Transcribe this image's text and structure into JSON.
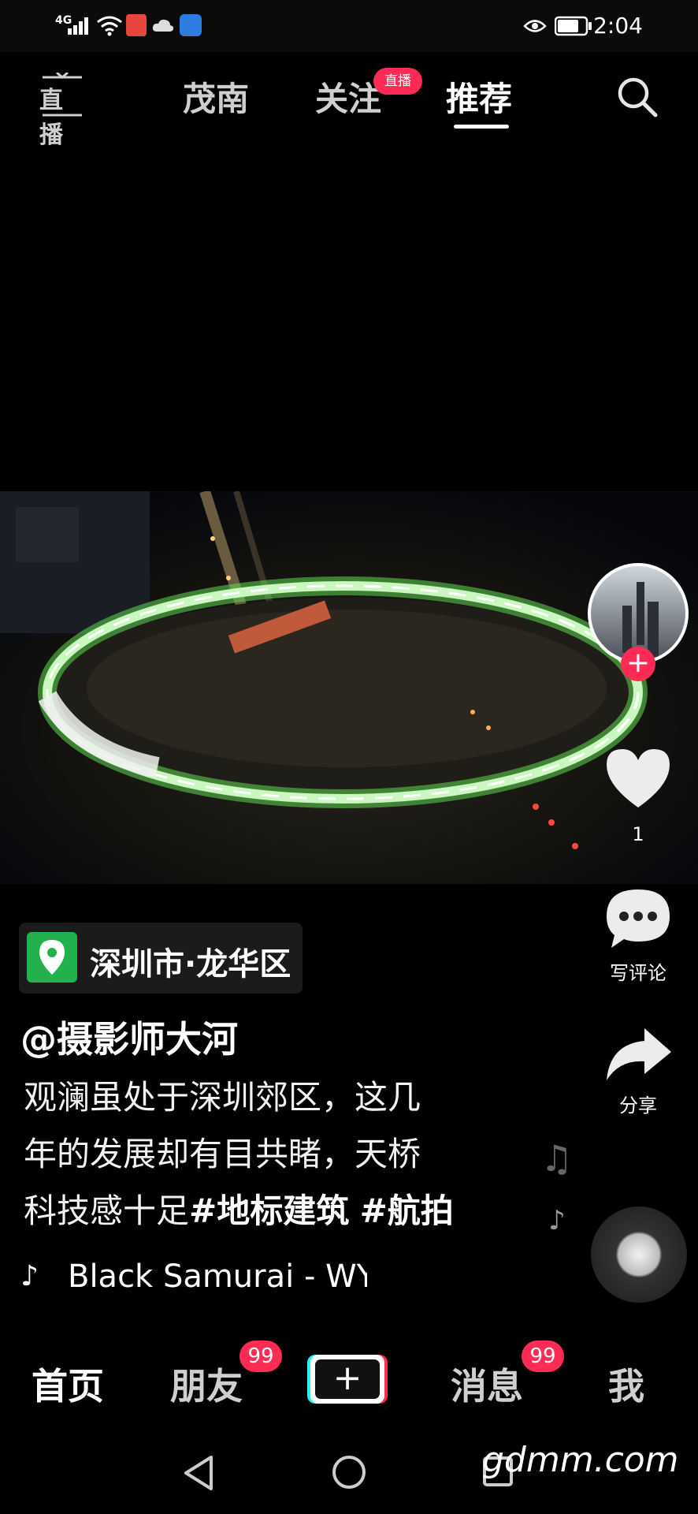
{
  "status_bar": {
    "network": "4G",
    "time": "2:04"
  },
  "top_nav": {
    "live_icon_label": "直播",
    "tabs": [
      {
        "label": "茂南",
        "active": false
      },
      {
        "label": "关注",
        "active": false,
        "badge": "直播"
      },
      {
        "label": "推荐",
        "active": true
      }
    ]
  },
  "rail": {
    "likes": "1",
    "comment_label": "写评论",
    "share_label": "分享"
  },
  "caption": {
    "location": "深圳市·龙华区",
    "author": "@摄影师大河",
    "lines": [
      "观澜虽处于深圳郊区，这几",
      "年的发展却有目共睹，天桥"
    ],
    "line3_text": "科技感十足",
    "tags": [
      "#地标建筑",
      "#航拍"
    ],
    "music": "Black Samurai - WY"
  },
  "bottom_nav": {
    "tabs": [
      "首页",
      "朋友",
      "消息",
      "我"
    ],
    "friends_badge": "99",
    "messages_badge": "99"
  },
  "watermark": "gdmm.com",
  "colors": {
    "accent": "#fe2c55",
    "location_green": "#22b14c",
    "ring_glow": "#7dff6a"
  }
}
